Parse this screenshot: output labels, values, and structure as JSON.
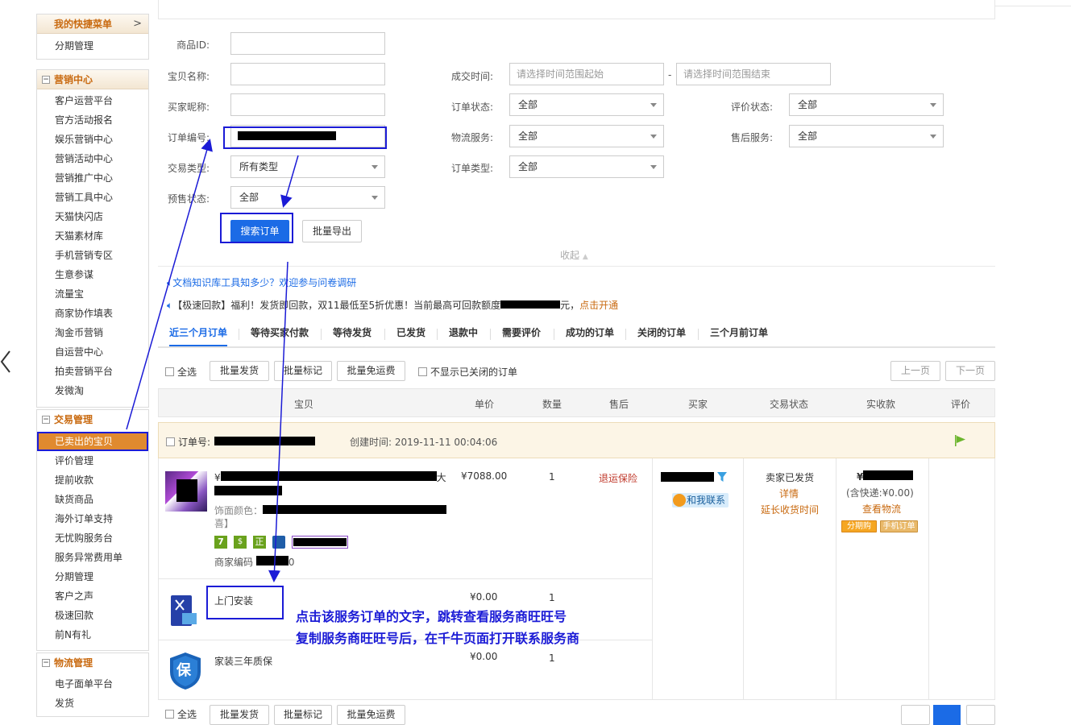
{
  "sidebar": {
    "quick_menu": {
      "title": "我的快捷菜单",
      "more": ">",
      "items": [
        "分期管理"
      ]
    },
    "marketing": {
      "title": "营销中心",
      "items": [
        "客户运营平台",
        "官方活动报名",
        "娱乐营销中心",
        "营销活动中心",
        "营销推广中心",
        "营销工具中心",
        "天猫快闪店",
        "天猫素材库",
        "手机营销专区",
        "生意参谋",
        "流量宝",
        "商家协作填表",
        "淘金币营销",
        "自运营中心",
        "拍卖营销平台",
        "发微淘"
      ]
    },
    "trade": {
      "title": "交易管理",
      "items": [
        "已卖出的宝贝",
        "评价管理",
        "提前收款",
        "缺货商品",
        "海外订单支持",
        "无忧购服务台",
        "服务异常费用单",
        "分期管理",
        "客户之声",
        "极速回款",
        "前N有礼"
      ]
    },
    "logistics": {
      "title": "物流管理",
      "items": [
        "电子面单平台",
        "发货"
      ]
    }
  },
  "form": {
    "product_id_label": "商品ID:",
    "item_name_label": "宝贝名称:",
    "buyer_nick_label": "买家昵称:",
    "order_no_label": "订单编号:",
    "trade_type_label": "交易类型:",
    "trade_type_value": "所有类型",
    "presale_label": "预售状态:",
    "presale_value": "全部",
    "deal_time_label": "成交时间:",
    "time_start_placeholder": "请选择时间范围起始",
    "time_dash": "-",
    "time_end_placeholder": "请选择时间范围结束",
    "order_status_label": "订单状态:",
    "order_status_value": "全部",
    "logistics_label": "物流服务:",
    "logistics_value": "全部",
    "order_type_label": "订单类型:",
    "order_type_value": "全部",
    "review_status_label": "评价状态:",
    "review_status_value": "全部",
    "aftersale_label": "售后服务:",
    "aftersale_value": "全部",
    "search_button": "搜索订单",
    "export_button": "批量导出",
    "collapse": "收起"
  },
  "notices": {
    "survey": "文档知识库工具知多少？欢迎参与问卷调研",
    "promo_prefix": "【极速回款】福利！发货即回款，双11最低至5折优惠！当前最高可回款额度",
    "promo_suffix": "元，",
    "promo_link": "点击开通"
  },
  "tabs": [
    "近三个月订单",
    "等待买家付款",
    "等待发货",
    "已发货",
    "退款中",
    "需要评价",
    "成功的订单",
    "关闭的订单",
    "三个月前订单"
  ],
  "toolbar": {
    "select_all": "全选",
    "batch_ship": "批量发货",
    "batch_mark": "批量标记",
    "batch_free_shipping": "批量免运费",
    "hide_closed": "不显示已关闭的订单",
    "prev_page": "上一页",
    "next_page": "下一页"
  },
  "table_headers": [
    "宝贝",
    "单价",
    "数量",
    "售后",
    "买家",
    "交易状态",
    "实收款",
    "评价"
  ],
  "order": {
    "order_no_label": "订单号:",
    "created_label": "创建时间: 2019-11-11 00:04:06",
    "item_title_start": "¥",
    "item_title_end": "大",
    "item_attr_label": "饰面颜色：",
    "item_attr_end": "喜】",
    "item_badges": [
      "7",
      "$",
      "正"
    ],
    "merchant_code_label": "商家编码",
    "merchant_code_end": "0",
    "price": "¥7088.00",
    "qty": "1",
    "aftersale_link": "退运保险",
    "contact_me": "和我联系",
    "status": "卖家已发货",
    "details": "详情",
    "extend_receipt": "延长收货时间",
    "amount_prefix": "¥",
    "amount_shipping": "(含快递:¥0.00)",
    "view_logistics": "查看物流",
    "tag_installment": "分期购",
    "tag_mobile": "手机订单",
    "service_item_1": "上门安装",
    "service_item_1_price": "¥0.00",
    "service_item_1_qty": "1",
    "service_item_2": "家装三年质保",
    "service_item_2_price": "¥0.00",
    "service_item_2_qty": "1",
    "warranty_icon_text": "保"
  },
  "annotation": {
    "line1": "点击该服务订单的文字，跳转查看服务商旺旺号",
    "line2": "复制服务商旺旺号后，在千牛页面打开联系服务商"
  },
  "colors": {
    "accent_blue": "#1b6be6",
    "annotation_blue": "#1b1bd6",
    "orange": "#c96a10"
  }
}
